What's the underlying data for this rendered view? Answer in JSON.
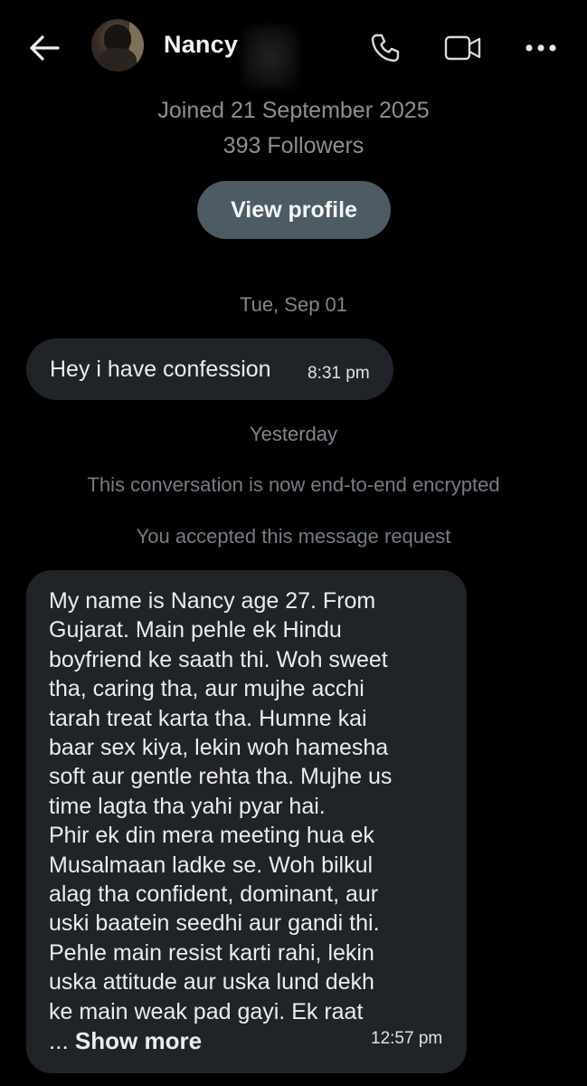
{
  "header": {
    "contact_name": "Nancy",
    "icons": {
      "back": "arrow-left-icon",
      "call": "phone-icon",
      "video": "video-camera-icon",
      "more": "more-horizontal-icon"
    }
  },
  "profile": {
    "joined": "Joined 21 September 2025",
    "followers": "393 Followers",
    "view_profile_label": "View profile"
  },
  "conversation": {
    "date_1": "Tue, Sep 01",
    "message_1": {
      "text": "Hey i have confession",
      "time": "8:31 pm"
    },
    "date_2": "Yesterday",
    "system_1": "This conversation is now end-to-end encrypted",
    "system_2": "You accepted this message request",
    "message_2": {
      "text": "My name is Nancy age 27. From\nGujarat. Main pehle ek Hindu\nboyfriend ke saath thi. Woh sweet\ntha, caring tha, aur mujhe acchi\ntarah treat karta tha. Humne kai\nbaar sex kiya, lekin woh hamesha\nsoft aur gentle rehta tha. Mujhe us\ntime lagta tha yahi pyar hai.\nPhir ek din mera meeting hua ek\nMusalmaan ladke se. Woh bilkul\nalag tha confident, dominant, aur\nuski baatein seedhi aur gandi thi.\nPehle main resist karti rahi, lekin\nuska attitude aur uska lund dekh\nke main weak pad gayi. Ek raat",
      "ellipsis": "... ",
      "show_more_label": "Show more",
      "time": "12:57 pm"
    }
  },
  "colors": {
    "background": "#000000",
    "bubble": "#202327",
    "button": "#4d5b65",
    "muted_text": "#8b9097"
  }
}
